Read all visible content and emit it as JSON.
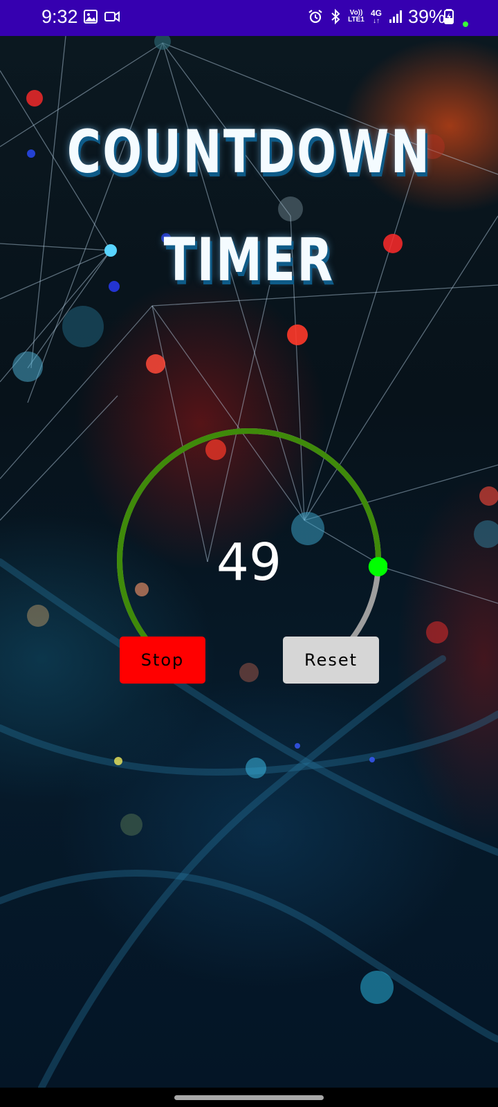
{
  "status_bar": {
    "time": "9:32",
    "volte_text": "Vo))\nLTE1",
    "network_text": "4G",
    "battery_percent": "39%",
    "icons": [
      "gallery-icon",
      "video-camera-icon",
      "alarm-icon",
      "bluetooth-icon",
      "volte-icon",
      "network-4g-icon",
      "signal-icon",
      "battery-charging-icon",
      "privacy-dot-icon"
    ]
  },
  "app": {
    "title_line1": "COUNTDOWN",
    "title_line2": "TIMER",
    "timer": {
      "value": "49",
      "progress_fraction": 0.82,
      "colors": {
        "progress": "#3f8a0a",
        "track": "#9e9e9e",
        "thumb": "#00ff00"
      }
    },
    "buttons": {
      "stop_label": "Stop",
      "reset_label": "Reset",
      "stop_color": "#ff0000",
      "reset_color": "#d6d6d6"
    }
  },
  "colors": {
    "status_bar_bg": "#3600b0"
  }
}
